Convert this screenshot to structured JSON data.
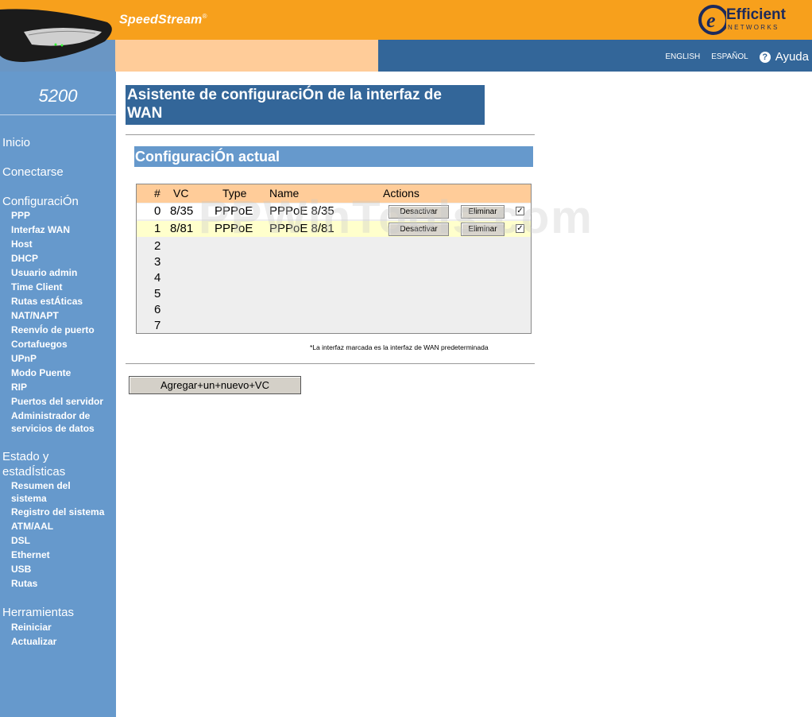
{
  "header": {
    "brand": "SpeedStream",
    "brand_mark": "®",
    "logo_name": "Efficient",
    "logo_sub": "NETWORKS",
    "lang_english": "ENGLISH",
    "lang_espanol": "ESPAÑOL",
    "help": "Ayuda"
  },
  "sidebar": {
    "model": "5200",
    "inicio": "Inicio",
    "conectarse": "Conectarse",
    "configuracion": "ConfiguraciÓn",
    "config_items": [
      "PPP",
      "Interfaz WAN",
      "Host",
      "DHCP",
      "Usuario admin",
      "Time Client",
      "Rutas estÁticas",
      "NAT/NAPT",
      "ReenvÍo de puerto",
      "Cortafuegos",
      "UPnP",
      "Modo Puente",
      "RIP",
      "Puertos del servidor",
      "Administrador de",
      "servicios de datos"
    ],
    "estado_1": "Estado y",
    "estado_2": "estadÍsticas",
    "estado_items": [
      "Resumen del",
      "sistema",
      "Registro del sistema",
      "ATM/AAL",
      "DSL",
      "Ethernet",
      "USB",
      "Rutas"
    ],
    "herramientas": "Herramientas",
    "herr_items": [
      "Reiniciar",
      "Actualizar"
    ]
  },
  "main": {
    "title_1": "Asistente de configuraciÓn de la interfaz de",
    "title_2": "WAN",
    "subtitle": "ConfiguraciÓn actual",
    "columns": [
      "#",
      "VC",
      "Type",
      "Name",
      "Actions"
    ],
    "rows": [
      {
        "num": "0",
        "vc": "8/35",
        "type": "PPPoE",
        "name": "PPPoE 8/35",
        "btn1": "Desactivar",
        "btn2": "Eliminar",
        "checked": "✓"
      },
      {
        "num": "1",
        "vc": "8/81",
        "type": "PPPoE",
        "name": "PPPoE 8/81",
        "btn1": "Desactivar",
        "btn2": "Eliminar",
        "checked": "✓"
      }
    ],
    "empty_rows": [
      "2",
      "3",
      "4",
      "5",
      "6",
      "7"
    ],
    "note": "*La interfaz marcada es la interfaz de WAN predeterminada",
    "add_button": "Agregar+un+nuevo+VC",
    "watermark": "PPWinTools.com"
  }
}
